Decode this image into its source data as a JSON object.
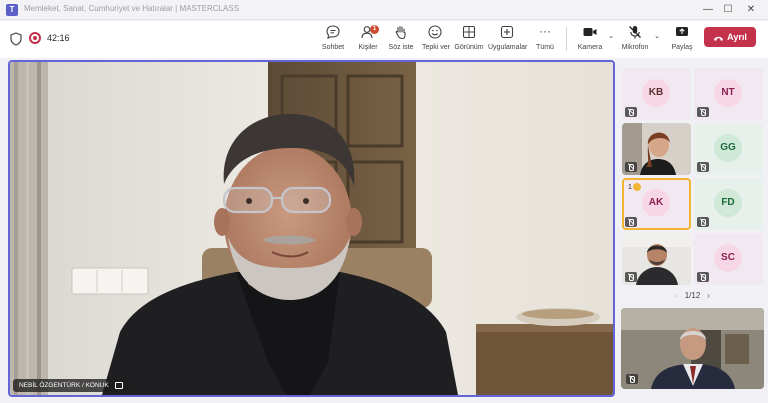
{
  "window": {
    "title": "Memleket, Sanat, Cumhuriyet ve Hatıralar | MASTERCLASS",
    "app_logo_letter": "T",
    "controls": {
      "minimize": "—",
      "maximize": "☐",
      "close": "✕"
    }
  },
  "toolbar": {
    "timer": "42:16",
    "tools": [
      {
        "id": "chat",
        "label": "Sohbet",
        "icon": "chat-icon"
      },
      {
        "id": "people",
        "label": "Kişiler",
        "icon": "people-icon",
        "badge": "1"
      },
      {
        "id": "raise",
        "label": "Söz iste",
        "icon": "hand-icon"
      },
      {
        "id": "react",
        "label": "Tepki ver",
        "icon": "smile-icon"
      },
      {
        "id": "view",
        "label": "Görünüm",
        "icon": "grid-icon"
      },
      {
        "id": "apps",
        "label": "Uygulamalar",
        "icon": "apps-icon"
      },
      {
        "id": "more",
        "label": "Tümü",
        "icon": "more-icon"
      }
    ],
    "camera_label": "Kamera",
    "mic_label": "Mikrofon",
    "share_label": "Paylaş",
    "leave_label": "Ayrıl",
    "caret": "⌄",
    "more_dots": "···"
  },
  "main_video": {
    "speaker_name": "NEBİL ÖZGENTÜRK / KONUK"
  },
  "gallery": {
    "tiles": [
      {
        "initials": "KB",
        "color": "#5b2e2e",
        "bg": "#f3e4ee"
      },
      {
        "initials": "NT",
        "color": "#8a2050",
        "bg": "#f3e4ee"
      },
      {
        "video": true
      },
      {
        "initials": "GG",
        "color": "#1d6b3a",
        "bg": "#e7f0ea"
      },
      {
        "initials": "AK",
        "color": "#8a2050",
        "bg": "#f3e4ee",
        "active": true,
        "raise": "1"
      },
      {
        "initials": "FD",
        "color": "#1d6b3a",
        "bg": "#e7f0ea"
      },
      {
        "video": true
      },
      {
        "initials": "SC",
        "color": "#8a2050",
        "bg": "#f3e4ee"
      }
    ],
    "pager": {
      "text": "1/12",
      "prev": "‹",
      "next": "›"
    }
  },
  "colors": {
    "accent": "#6264d7",
    "leave": "#c4314b",
    "active_border": "#f2b433"
  }
}
